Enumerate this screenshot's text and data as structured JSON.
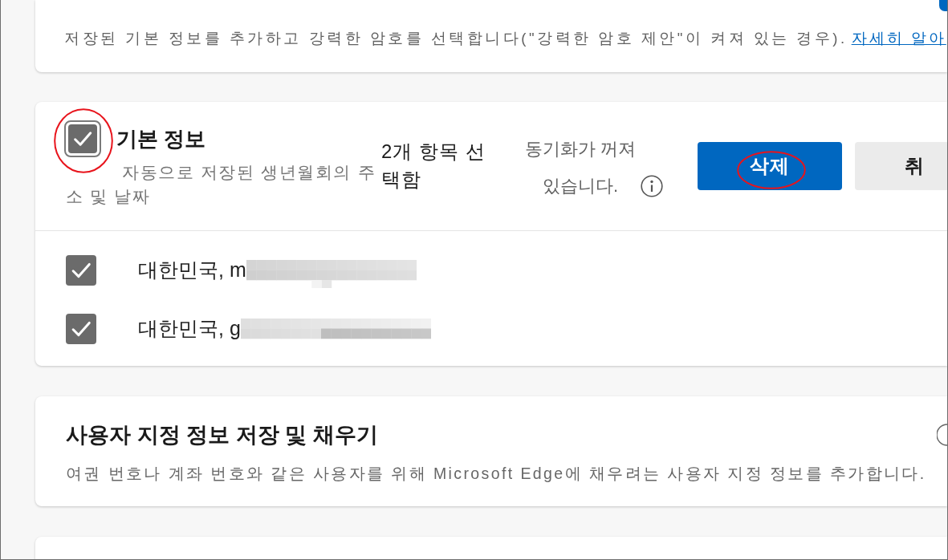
{
  "basic_info_fill": {
    "description": "저장된 기본 정보를 추가하고 강력한 암호를 선택합니다(\"강력한 암호 제안\"이 켜져 있는 경우).",
    "link": "자세히 알아",
    "toggle": {
      "on": true
    }
  },
  "basic_info": {
    "header": {
      "checked": true,
      "highlighted": true,
      "title": "기본 정보",
      "subtitle": "자동으로 저장된 생년월회의 주소 및 날짜"
    },
    "selection_count": "2개 항목 선택함",
    "sync_status": "동기화가 꺼져 있습니다.",
    "buttons": [
      {
        "kind": "primary",
        "label": "삭제",
        "highlighted": true
      },
      {
        "kind": "secondary",
        "label": "취",
        "highlighted": false
      }
    ],
    "items": [
      {
        "label": "대한민국, m",
        "checked": true
      },
      {
        "label": "대한민국, g",
        "checked": true
      }
    ]
  },
  "custom_info": {
    "title": "사용자 지정 정보 저장 및 채우기",
    "description": "여권 번호나 계좌 번호와 같은 사용자를 위해 Microsoft Edge에 채우려는 사용자 지정 정보를 추가합니다.",
    "toggle": {
      "on": false
    }
  }
}
